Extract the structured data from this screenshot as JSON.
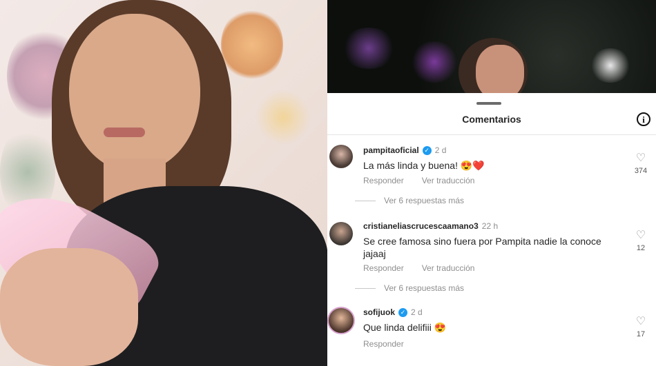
{
  "panel": {
    "title": "Comentarios"
  },
  "comments": [
    {
      "user": "pampitaoficial",
      "verified": true,
      "time": "2 d",
      "text": "La más linda y buena! 😍❤️",
      "reply_label": "Responder",
      "translate_label": "Ver traducción",
      "likes": "374",
      "replies_label": "Ver 6 respuestas más"
    },
    {
      "user": "cristianeliascrucescaamano3",
      "verified": false,
      "time": "22 h",
      "text": "Se cree famosa sino fuera por Pampita nadie la conoce jajaaj",
      "reply_label": "Responder",
      "translate_label": "Ver traducción",
      "likes": "12",
      "replies_label": "Ver 6 respuestas más"
    },
    {
      "user": "sofijuok",
      "verified": true,
      "time": "2 d",
      "text": "Que linda delifiii 😍",
      "reply_label": "Responder",
      "likes": "17"
    }
  ],
  "icons": {
    "info": "info-icon",
    "verified": "verified-badge-icon",
    "like": "heart-icon"
  }
}
